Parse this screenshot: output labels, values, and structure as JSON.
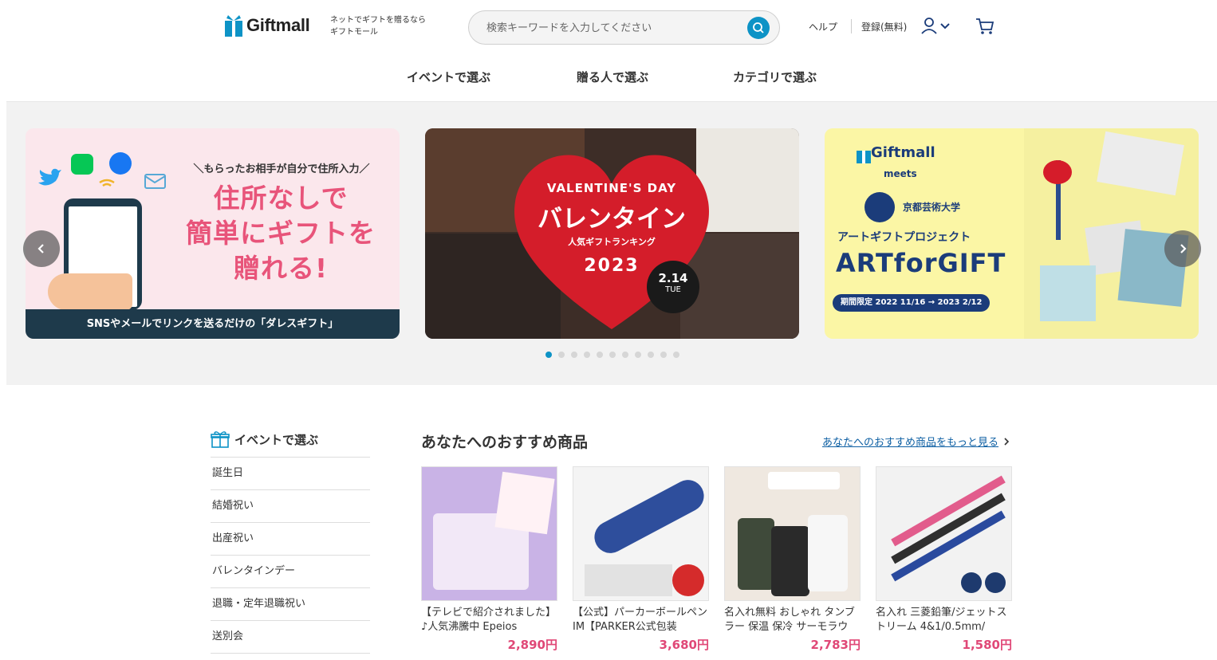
{
  "header": {
    "logo": "Giftmall",
    "tagline": [
      "ネットでギフトを贈るなら",
      "ギフトモール"
    ],
    "search_placeholder": "検索キーワードを入力してください",
    "help": "ヘルプ",
    "register": "登録(無料)"
  },
  "nav": [
    "イベントで選ぶ",
    "贈る人で選ぶ",
    "カテゴリで選ぶ"
  ],
  "slides": {
    "s1": {
      "sub": "＼もらったお相手が自分で住所入力／",
      "title": [
        "住所なしで",
        "簡単にギフトを",
        "贈れる!"
      ],
      "footer": "SNSやメールでリンクを送るだけの「ダレスギフト」"
    },
    "s2": {
      "vday": "VALENTINE'S DAY",
      "title": "バレンタイン",
      "ranking": "人気ギフトランキング",
      "year": "2023",
      "date": "2.14",
      "weekday": "TUE"
    },
    "s3": {
      "logo": "Giftmall",
      "meets": "meets",
      "univ": "京都芸術大学",
      "project": "アートギフトプロジェクト",
      "art": "ARTforGIFT",
      "period": "期間限定 2022 11/16 → 2023 2/12"
    },
    "dot_count": 11,
    "active_dot": 0
  },
  "sidebar": {
    "heading": "イベントで選ぶ",
    "items": [
      "誕生日",
      "結婚祝い",
      "出産祝い",
      "バレンタインデー",
      "退職・定年退職祝い",
      "送別会"
    ]
  },
  "recommend": {
    "title": "あなたへのおすすめ商品",
    "more": "あなたへのおすすめ商品をもっと見る",
    "products": [
      {
        "name": "【テレビで紹介されました】♪人気沸騰中 Epeios",
        "price": "2,890円"
      },
      {
        "name": "【公式】パーカーボールペンIM【PARKER公式包装",
        "price": "3,680円"
      },
      {
        "name": "名入れ無料 おしゃれ タンブラー 保温 保冷 サーモラウ",
        "price": "2,783円"
      },
      {
        "name": "名入れ 三菱鉛筆/ジェットストリーム 4&1/0.5mm/",
        "price": "1,580円"
      }
    ]
  }
}
